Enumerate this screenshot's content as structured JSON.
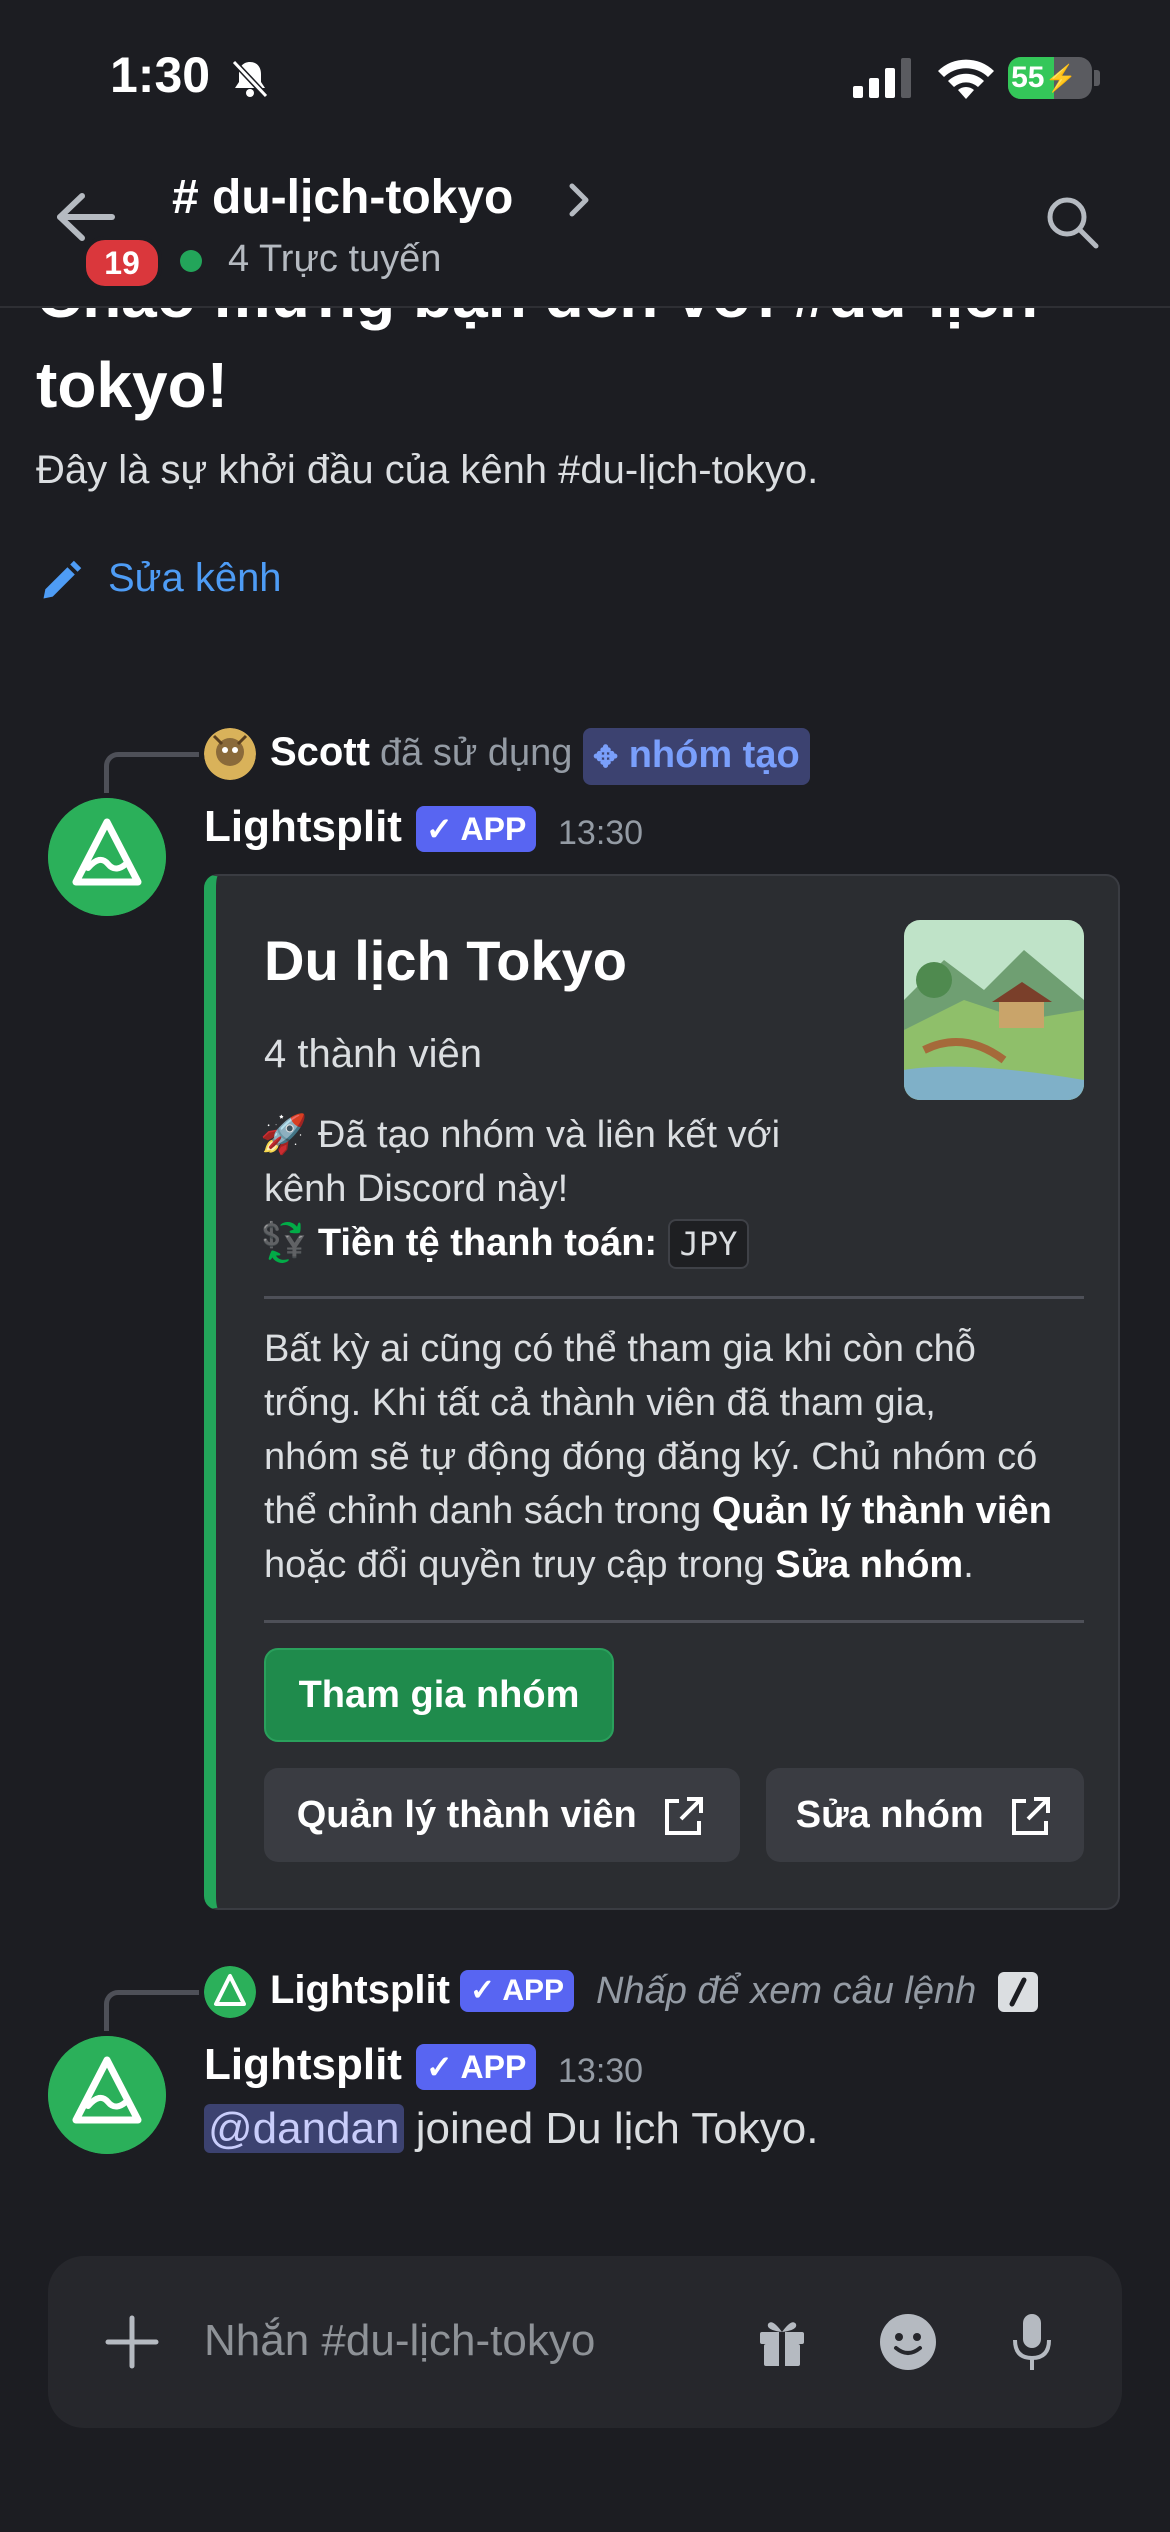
{
  "status_bar": {
    "time": "1:30",
    "battery": "55",
    "battery_level": 0.55
  },
  "header": {
    "channel_name": "# du-lịch-tokyo",
    "online_count": "4 Trực tuyến",
    "unread_badge": "19"
  },
  "welcome": {
    "title": "Chào mừng bạn đến với #du-lịch-tokyo!",
    "subtitle": "Đây là sự khởi đầu của kênh #du-lịch-tokyo.",
    "edit_channel_label": "Sửa kênh"
  },
  "message1": {
    "ref_user": "Scott",
    "ref_action": "đã sử dụng",
    "ref_command": "nhóm tạo",
    "author": "Lightsplit",
    "app_tag": "APP",
    "timestamp": "13:30",
    "embed": {
      "title": "Du lịch Tokyo",
      "members": "4 thành viên",
      "line1": "🚀 Đã tạo nhóm và liên kết với",
      "line2": "kênh Discord này!",
      "currency_label": "Tiền tệ thanh toán:",
      "currency_value": "JPY",
      "desc_line1": "Bất kỳ ai cũng có thể tham gia khi còn chỗ",
      "desc_line2": "trống. Khi tất cả thành viên đã tham gia,",
      "desc_line3": "nhóm sẽ tự động đóng đăng ký. Chủ nhóm có",
      "desc_line4_pre": "thể chỉnh danh sách trong ",
      "desc_line4_bold": "Quản lý thành viên",
      "desc_line5_pre": "hoặc đổi quyền truy cập trong ",
      "desc_line5_bold": "Sửa nhóm",
      "desc_line5_post": ".",
      "join_button": "Tham gia nhóm",
      "manage_button": "Quản lý thành viên",
      "edit_button": "Sửa nhóm"
    }
  },
  "message2": {
    "ref_user": "Lightsplit",
    "ref_app_tag": "APP",
    "ref_hint": "Nhấp để xem câu lệnh",
    "author": "Lightsplit",
    "app_tag": "APP",
    "timestamp": "13:30",
    "mention": "@dandan",
    "text": " joined Du lịch Tokyo."
  },
  "composer": {
    "placeholder": "Nhắn #du-lịch-tokyo"
  },
  "colors": {
    "accent": "#5865f2",
    "green": "#23a55a",
    "background": "#1c1d22",
    "link": "#4e9cf5"
  }
}
